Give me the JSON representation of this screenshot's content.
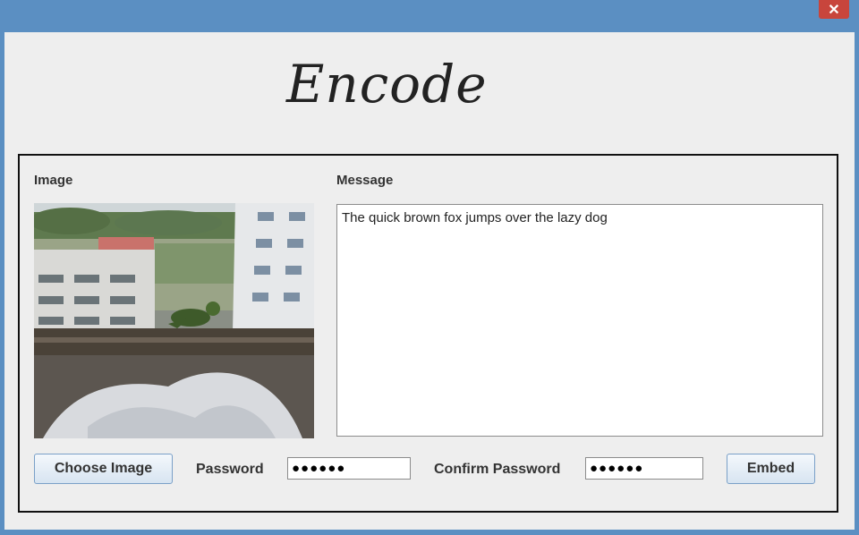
{
  "window": {
    "close_glyph": "✕"
  },
  "header": {
    "title": "Encode"
  },
  "image_section": {
    "label": "Image"
  },
  "message_section": {
    "label": "Message",
    "text": "The quick brown fox jumps over the lazy dog"
  },
  "controls": {
    "choose_image_label": "Choose Image",
    "password_label": "Password",
    "password_value": "●●●●●●",
    "confirm_password_label": "Confirm Password",
    "confirm_password_value": "●●●●●●",
    "embed_label": "Embed"
  },
  "colors": {
    "titlebar": "#5b8fc2",
    "close": "#c8453c",
    "window_bg": "#eeeeee"
  }
}
